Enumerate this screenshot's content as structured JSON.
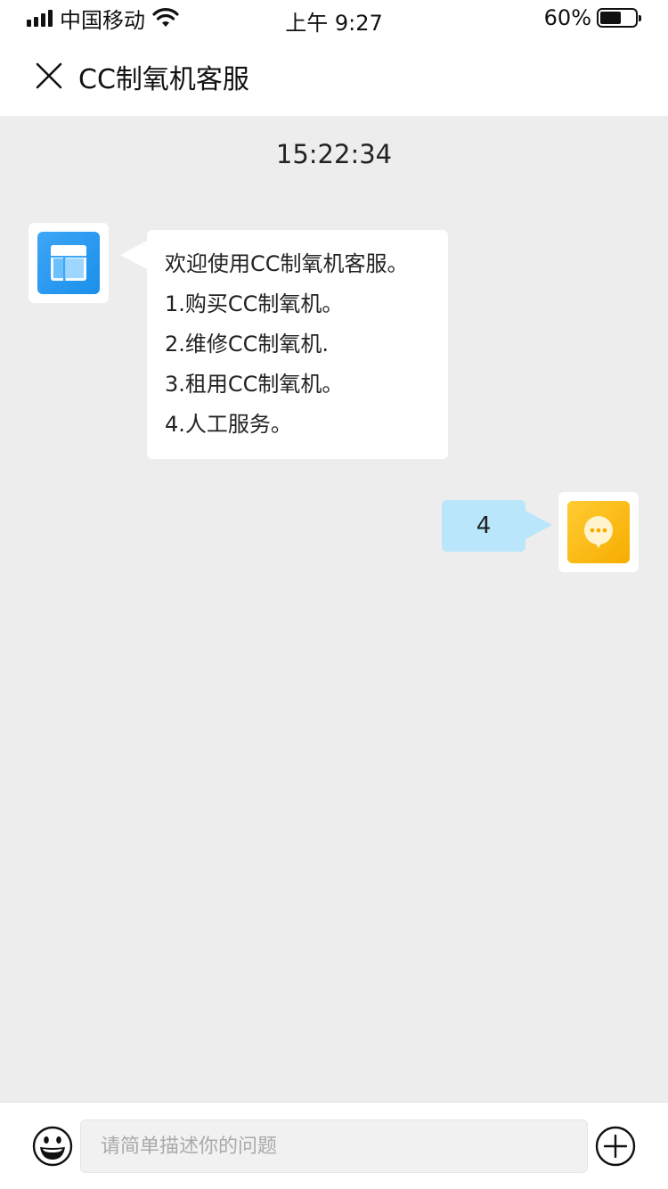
{
  "status_bar": {
    "carrier": "中国移动",
    "time": "上午 9:27",
    "battery_percent": "60%",
    "battery_level": 0.6
  },
  "header": {
    "title": "CC制氧机客服",
    "close_icon": "close-icon"
  },
  "chat": {
    "timestamp": "15:22:34",
    "messages": [
      {
        "sender": "agent",
        "avatar_icon": "layout-icon",
        "lines": [
          "欢迎使用CC制氧机客服。",
          "1.购买CC制氧机。",
          "2.维修CC制氧机.",
          "3.租用CC制氧机。",
          "4.人工服务。"
        ]
      },
      {
        "sender": "user",
        "avatar_icon": "chat-bubble-icon",
        "text": "4"
      }
    ]
  },
  "input_bar": {
    "placeholder": "请简单描述你的问题",
    "value": "",
    "emoji_icon": "emoji-icon",
    "plus_icon": "plus-icon"
  },
  "colors": {
    "background": "#ededed",
    "user_bubble": "#b9e6fb",
    "agent_avatar": "#2196f3",
    "user_avatar": "#fbbd08"
  }
}
